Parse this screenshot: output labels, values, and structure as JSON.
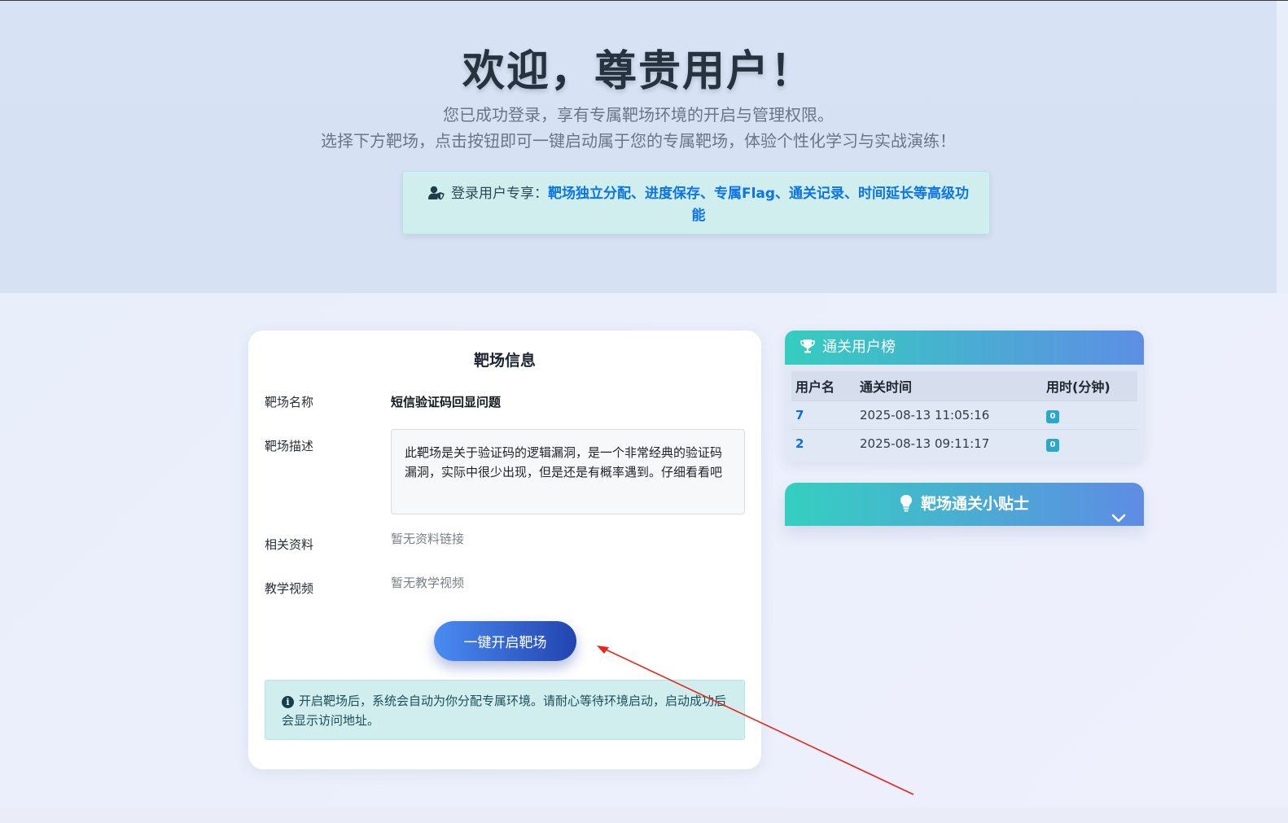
{
  "hero": {
    "title": "欢迎，尊贵用户！",
    "subtitle_line1": "您已成功登录，享有专属靶场环境的开启与管理权限。",
    "subtitle_line2": "选择下方靶场，点击按钮即可一键启动属于您的专属靶场，体验个性化学习与实战演练！",
    "notice_prefix": "登录用户专享：",
    "notice_features": "靶场独立分配、进度保存、专属Flag、通关记录、时间延长等高级功能",
    "notice_icon": "user-shield-icon"
  },
  "range_info": {
    "title": "靶场信息",
    "name_label": "靶场名称",
    "name_value": "短信验证码回显问题",
    "desc_label": "靶场描述",
    "desc_value": "此靶场是关于验证码的逻辑漏洞，是一个非常经典的验证码漏洞，实际中很少出现，但是还是有概率遇到。仔细看看吧",
    "resources_label": "相关资料",
    "resources_value": "暂无资料链接",
    "video_label": "教学视频",
    "video_value": "暂无教学视频",
    "start_button": "一键开启靶场",
    "info_text": "开启靶场后，系统会自动为你分配专属环境。请耐心等待环境启动，启动成功后会显示访问地址。",
    "info_icon": "info-circle-icon"
  },
  "leaderboard": {
    "title": "通关用户榜",
    "icon": "trophy-icon",
    "columns": [
      "用户名",
      "通关时间",
      "用时(分钟)"
    ],
    "rows": [
      {
        "user": "7",
        "time": "2025-08-13 11:05:16",
        "minutes": "0"
      },
      {
        "user": "2",
        "time": "2025-08-13 09:11:17",
        "minutes": "0"
      }
    ]
  },
  "tips": {
    "title": "靶场通关小贴士",
    "icon": "lightbulb-icon",
    "toggle_icon": "chevron-down-icon"
  },
  "colors": {
    "accent_teal": "#35cdbf",
    "accent_blue": "#5d8ee4",
    "button_start": "#4a8cf2",
    "button_end": "#2244b0",
    "link_blue": "#0c74e8",
    "annotation_red": "#e8261c"
  }
}
